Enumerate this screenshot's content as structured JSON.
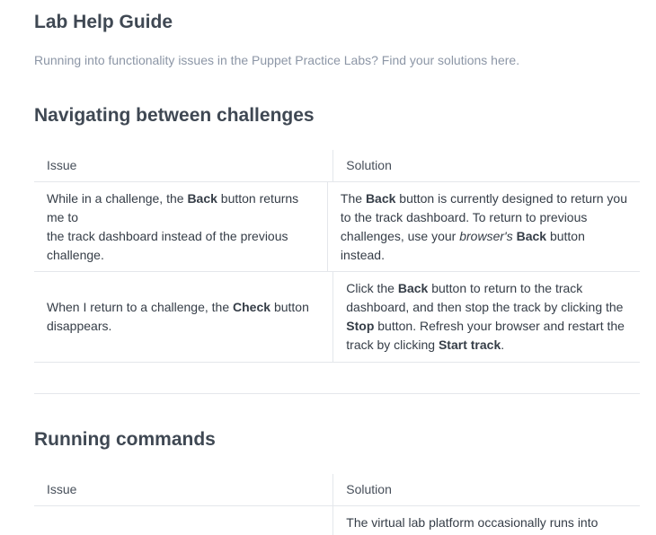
{
  "page": {
    "title": "Lab Help Guide",
    "intro": "Running into functionality issues in the Puppet Practice Labs? Find your solutions here."
  },
  "sections": [
    {
      "title": "Navigating between challenges",
      "headers": {
        "issue": "Issue",
        "solution": "Solution"
      },
      "rows": [
        {
          "issue": "While in a challenge, the Back button returns me to the track dashboard instead of the previous challenge.",
          "solution": "The Back button is currently designed to return you to the track dashboard. To return to previous challenges, use your browser's Back button instead."
        },
        {
          "issue": "When I return to a challenge, the Check button disappears.",
          "solution": "Click the Back button to return to the track dashboard, and then stop the track by clicking the Stop button. Refresh your browser and restart the track by clicking Start track."
        }
      ]
    },
    {
      "title": "Running commands",
      "headers": {
        "issue": "Issue",
        "solution": "Solution"
      },
      "rows": [
        {
          "issue": "",
          "solution": "The virtual lab platform occasionally runs into"
        }
      ]
    }
  ],
  "inline": {
    "back": "Back",
    "check": "Check",
    "stop": "Stop",
    "start_track": "Start track",
    "browsers": "browser's",
    "r1_issue_a": "While in a challenge, the",
    "r1_issue_b": "button returns me to",
    "r1_issue_c": "the track dashboard instead of the previous",
    "r1_issue_d": "challenge.",
    "r1_sol_a1": "The",
    "r1_sol_a2": "button is currently designed to return you",
    "r1_sol_b": "to the track dashboard. To return to previous",
    "r1_sol_c": "challenges, use your",
    "r1_sol_c2": "button",
    "r1_sol_d": "instead.",
    "r2_issue_a": "When I return to a challenge, the",
    "r2_issue_b": "button",
    "r2_issue_c": "disappears.",
    "r2_sol_a1": "Click the",
    "r2_sol_a2": "button to return to the track",
    "r2_sol_b": "dashboard, and then stop the track by clicking the",
    "r2_sol_c2": "button. Refresh your browser and restart the",
    "r2_sol_d1": "track by clicking",
    "period": "."
  }
}
